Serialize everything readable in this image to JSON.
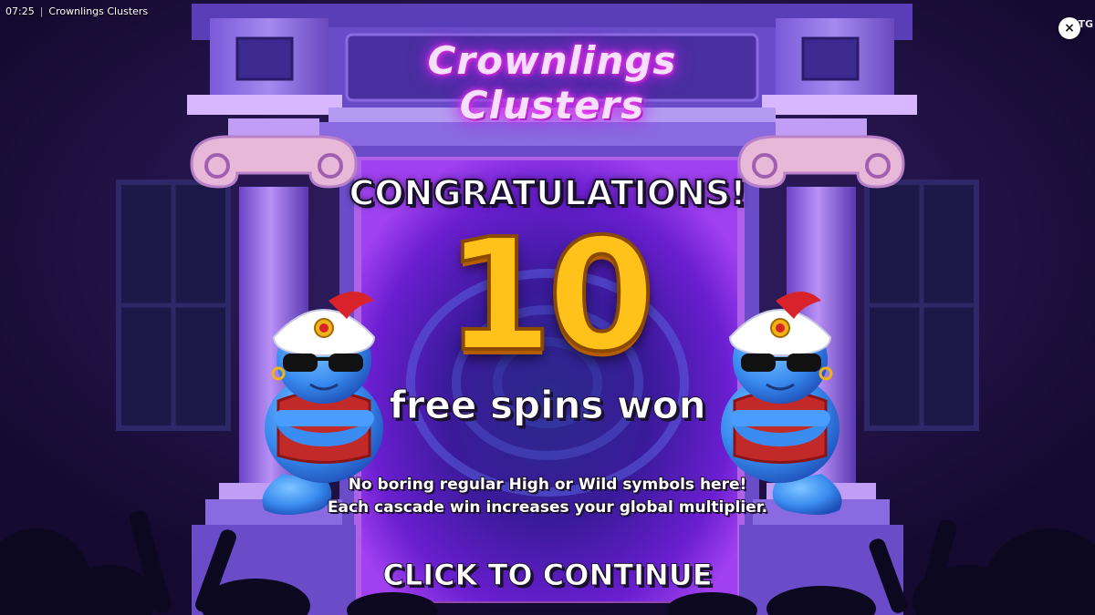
{
  "window": {
    "time": "07:25",
    "separator": "|",
    "title": "Crownlings Clusters",
    "corner_badge": "TG",
    "close_glyph": "×"
  },
  "game": {
    "logo_text": "Crownlings Clusters",
    "headline": "CONGRATULATIONS!",
    "free_spins_count": "10",
    "free_spins_label": "free spins won",
    "info_line_1": "No boring regular High or Wild symbols here!",
    "info_line_2": "Each cascade win increases your global multiplier.",
    "continue_label": "CLICK TO CONTINUE"
  },
  "icons": {
    "close": "close-icon",
    "mascot": "genie-mascot-icon"
  },
  "colors": {
    "background": "#1a0f3a",
    "neon_title": "#ff3df2",
    "number_gold": "#ffc21a",
    "portal": "#7a23d8",
    "genie_body": "#3a8cf0",
    "turban_plume": "#d8232a"
  }
}
